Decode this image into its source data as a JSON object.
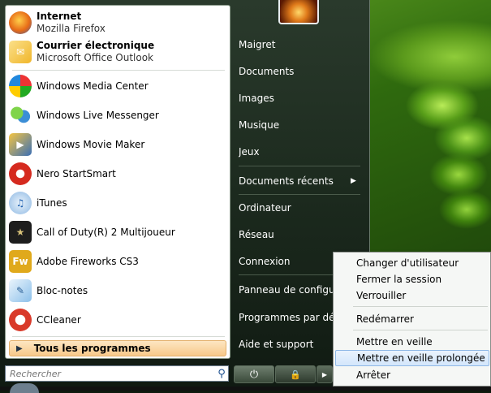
{
  "pinned": [
    {
      "name": "Internet",
      "sub": "Mozilla Firefox",
      "icon": "firefox-icon",
      "color": "#e76b17"
    },
    {
      "name": "Courrier électronique",
      "sub": "Microsoft Office Outlook",
      "icon": "outlook-icon",
      "color": "#f0b62b"
    }
  ],
  "recent": [
    {
      "name": "Windows Media Center",
      "icon": "media-center-icon",
      "color": "#2f9a3c"
    },
    {
      "name": "Windows Live Messenger",
      "icon": "messenger-icon",
      "color": "#3b8ed6"
    },
    {
      "name": "Windows Movie Maker",
      "icon": "movie-maker-icon",
      "color": "#3a6fb5"
    },
    {
      "name": "Nero StartSmart",
      "icon": "nero-icon",
      "color": "#d52a1f"
    },
    {
      "name": "iTunes",
      "icon": "itunes-icon",
      "color": "#3d7dd1"
    },
    {
      "name": "Call of Duty(R) 2 Multijoueur",
      "icon": "call-of-duty-icon",
      "color": "#2b2b2b"
    },
    {
      "name": "Adobe Fireworks CS3",
      "icon": "fireworks-icon",
      "color": "#d9a21a"
    },
    {
      "name": "Bloc-notes",
      "icon": "notepad-icon",
      "color": "#5ea0d8"
    },
    {
      "name": "CCleaner",
      "icon": "ccleaner-icon",
      "color": "#d93a2a"
    }
  ],
  "all_programs": "Tous les programmes",
  "search_placeholder": "Rechercher",
  "right_links": [
    "Maigret",
    "Documents",
    "Images",
    "Musique",
    "Jeux",
    "Documents récents",
    "Ordinateur",
    "Réseau",
    "Connexion",
    "Panneau de configurati",
    "Programmes par défaut",
    "Aide et support"
  ],
  "power_menu": [
    "Changer d'utilisateur",
    "Fermer la session",
    "Verrouiller",
    "Redémarrer",
    "Mettre en veille",
    "Mettre en veille prolongée",
    "Arrêter"
  ],
  "highlighted_power_item": "Mettre en veille prolongée"
}
